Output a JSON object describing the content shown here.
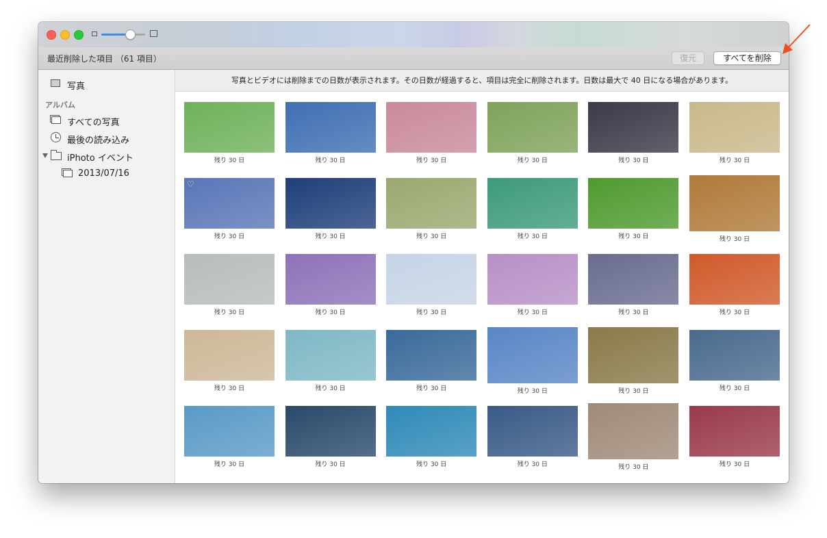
{
  "window": {
    "toolbar_title": "最近削除した項目 （61 項目）",
    "restore_label": "復元",
    "delete_all_label": "すべてを削除"
  },
  "sidebar": {
    "items": [
      {
        "label": "写真",
        "icon": "photos-icon"
      },
      {
        "label": "すべての写真",
        "icon": "all-photos-icon"
      },
      {
        "label": "最後の読み込み",
        "icon": "clock-icon"
      },
      {
        "label": "iPhoto イベント",
        "icon": "folder-icon"
      },
      {
        "label": "2013/07/16",
        "icon": "event-icon"
      }
    ],
    "section_albums": "アルバム"
  },
  "banner": "写真とビデオには削除までの日数が表示されます。その日数が経過すると、項目は完全に削除されます。日数は最大で 40 日になる場合があります。",
  "photos": [
    {
      "caption": "残り 30 日",
      "color": "#6fb15a"
    },
    {
      "caption": "残り 30 日",
      "color": "#3f6fb3"
    },
    {
      "caption": "残り 30 日",
      "color": "#c98a9a"
    },
    {
      "caption": "残り 30 日",
      "color": "#7fa35a"
    },
    {
      "caption": "残り 30 日",
      "color": "#3a3a48"
    },
    {
      "caption": "残り 30 日",
      "color": "#c9b88a"
    },
    {
      "caption": "残り 30 日",
      "color": "#5a76b8",
      "favorite": true
    },
    {
      "caption": "残り 30 日",
      "color": "#1f3f7a"
    },
    {
      "caption": "残り 30 日",
      "color": "#9ba870"
    },
    {
      "caption": "残り 30 日",
      "color": "#3d9a7a"
    },
    {
      "caption": "残り 30 日",
      "color": "#4f9a2f"
    },
    {
      "caption": "残り 30 日",
      "color": "#b07a3a"
    },
    {
      "caption": "残り 30 日",
      "color": "#b8bcbc"
    },
    {
      "caption": "残り 30 日",
      "color": "#8e72b8"
    },
    {
      "caption": "残り 30 日",
      "color": "#c6d4e6"
    },
    {
      "caption": "残り 30 日",
      "color": "#b890c6"
    },
    {
      "caption": "残り 30 日",
      "color": "#6a6c90"
    },
    {
      "caption": "残り 30 日",
      "color": "#d05a2a"
    },
    {
      "caption": "残り 30 日",
      "color": "#cdb898"
    },
    {
      "caption": "残り 30 日",
      "color": "#7fb8c6"
    },
    {
      "caption": "残り 30 日",
      "color": "#3a6a9a"
    },
    {
      "caption": "残り 30 日",
      "color": "#5a86c6"
    },
    {
      "caption": "残り 30 日",
      "color": "#8a7a4a"
    },
    {
      "caption": "残り 30 日",
      "color": "#4a6a8e"
    },
    {
      "caption": "残り 30 日",
      "color": "#5a9ac6"
    },
    {
      "caption": "残り 30 日",
      "color": "#2a4a6a"
    },
    {
      "caption": "残り 30 日",
      "color": "#2f8ab8"
    },
    {
      "caption": "残り 30 日",
      "color": "#3a5a86"
    },
    {
      "caption": "残り 30 日",
      "color": "#a08a78"
    },
    {
      "caption": "残り 30 日",
      "color": "#9a3a4a"
    }
  ],
  "colors": {
    "accent": "#3f8ce6",
    "arrow": "#f04e23"
  }
}
